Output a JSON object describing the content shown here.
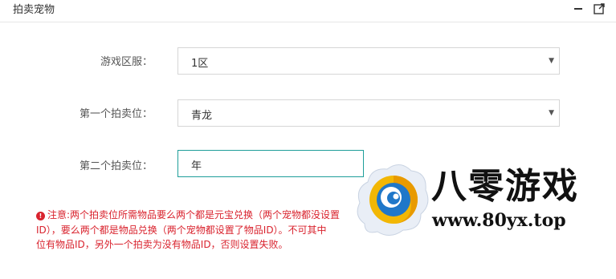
{
  "panel": {
    "title": "拍卖宠物",
    "minimize_icon": "minimize-icon",
    "maximize_icon": "expand-icon"
  },
  "form": {
    "server": {
      "label": "游戏区服：",
      "value": "1区"
    },
    "slot1": {
      "label": "第一个拍卖位：",
      "value": "青龙"
    },
    "slot2": {
      "label": "第二个拍卖位：",
      "value": "年"
    }
  },
  "warning": {
    "icon": "exclamation-icon",
    "lines": [
      "注意:两个拍卖位所需物品要么两个都是元宝兑换（两个宠物都没设置",
      "ID），要么两个都是物品兑换（两个宠物都设置了物品ID）。不可其中",
      "位有物品ID，另外一个拍卖为没有物品ID，否则设置失败。"
    ]
  },
  "watermark": {
    "title": "八零游戏",
    "url": "www.80yx.top",
    "logo_icon": "swirl-logo-icon"
  },
  "colors": {
    "warning_red": "#d9232e",
    "focus_teal": "#1e9e9a",
    "border_gray": "#d6d6d6"
  }
}
